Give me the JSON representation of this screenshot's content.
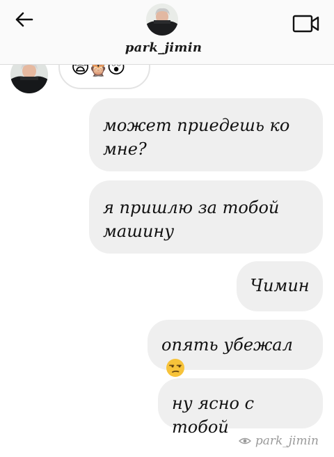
{
  "header": {
    "username": "park_jimin",
    "back_icon": "arrow-left-icon",
    "video_icon": "video-camera-icon",
    "avatar": "profile-photo"
  },
  "thread": {
    "received_partial": {
      "avatar": "profile-photo",
      "emojis": "😨🦉😲"
    },
    "sent_messages": [
      {
        "text": "может приедешь ко\nмне?"
      },
      {
        "text": "я пришлю за тобой\nмашину"
      },
      {
        "text": "Чимин"
      },
      {
        "text": "опять убежал",
        "emoji": "unamused-face"
      },
      {
        "text": "ну ясно с тобой"
      }
    ],
    "seen_by": "park_jimin",
    "seen_icon": "eye-icon"
  },
  "colors": {
    "header_bg": "#fafafa",
    "bubble_bg": "#efefef",
    "text": "#111111",
    "seen_text": "#9a9a9a"
  }
}
